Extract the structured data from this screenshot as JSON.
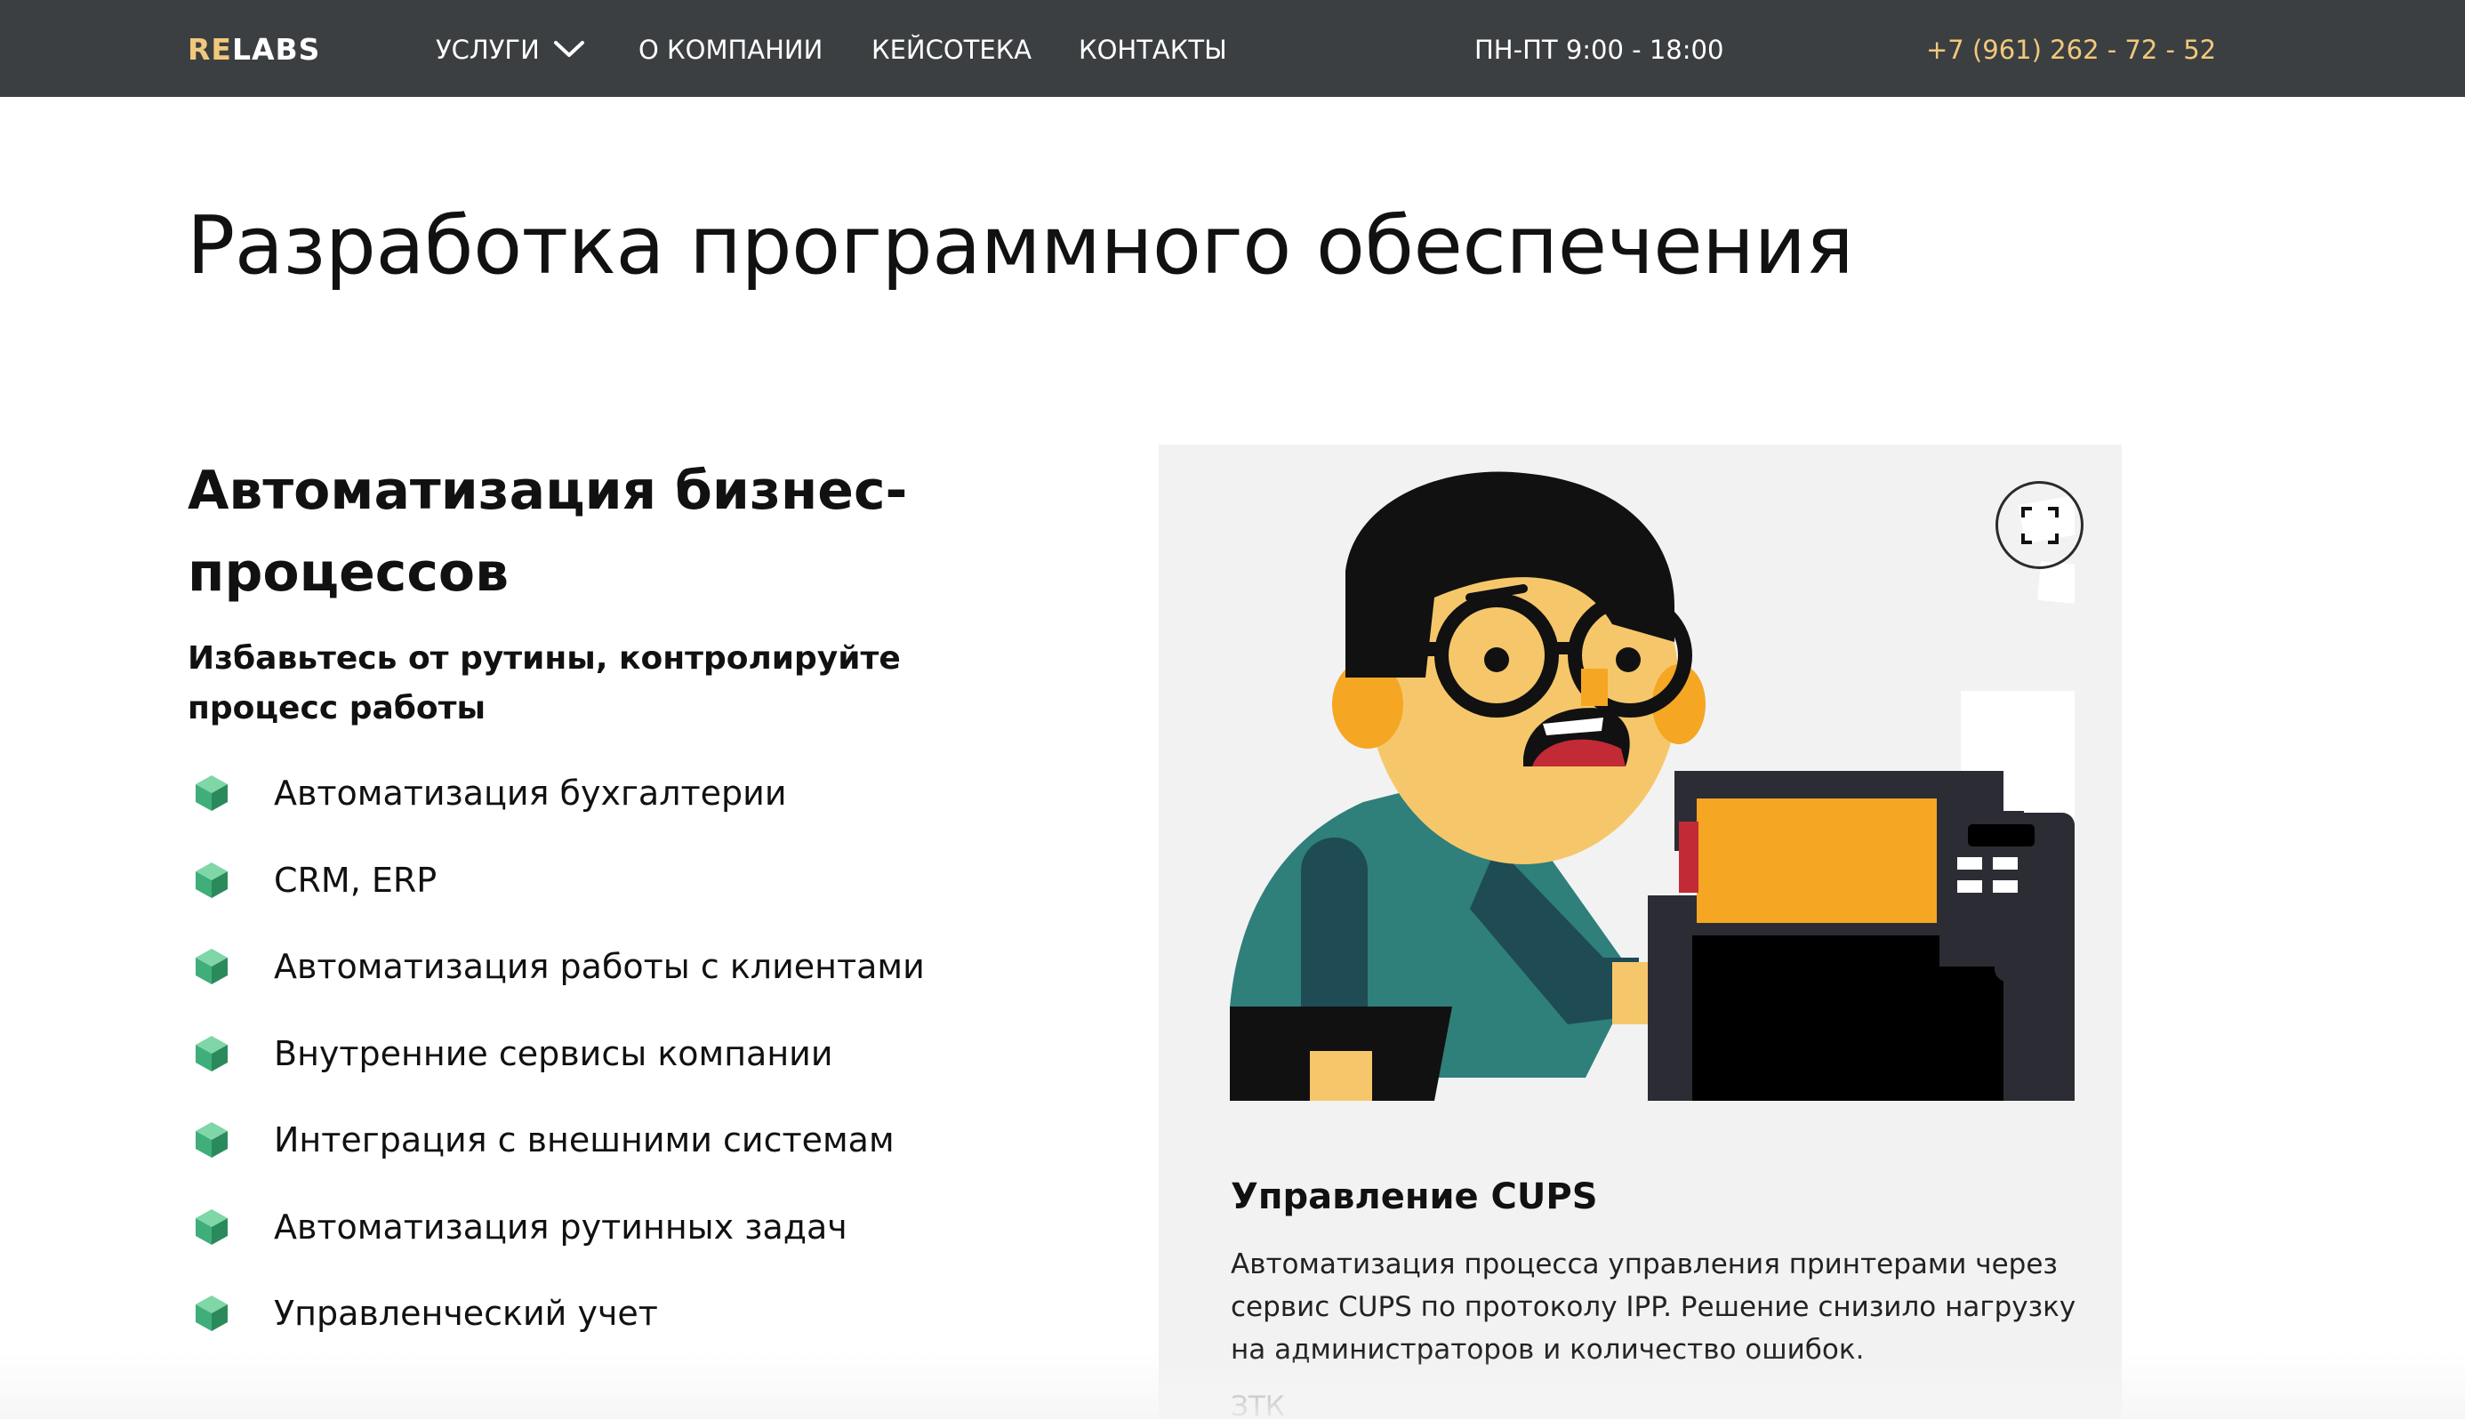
{
  "header": {
    "logo_re": "RE",
    "logo_labs": "LABS",
    "nav": {
      "services": "УСЛУГИ",
      "about": "О КОМПАНИИ",
      "cases": "КЕЙСОТЕКА",
      "contacts": "КОНТАКТЫ"
    },
    "hours": "ПН-ПТ 9:00 - 18:00",
    "phone": "+7 (961) 262 - 72 - 52"
  },
  "page_title": "Разработка программного обеспечения",
  "section": {
    "title": "Автоматизация бизнес-процессов",
    "subtitle": "Избавьтесь от рутины, контролируйте процесс работы",
    "features": [
      "Автоматизация бухгалтерии",
      "CRM, ERP",
      "Автоматизация работы с клиентами",
      "Внутренние сервисы компании",
      "Интеграция с внешними системам",
      "Автоматизация рутинных задач",
      "Управленческий учет"
    ]
  },
  "case_card": {
    "title": "Управление CUPS",
    "description": "Автоматизация процесса управления принтерами через сервис CUPS по протоколу IPP. Решение снизило нагрузку на администраторов и количество ошибок.",
    "client": "ЗТК"
  },
  "colors": {
    "header_bg": "#3c3f41",
    "accent_gold": "#f1c97c",
    "card_bg": "#f2f2f2",
    "cube_green": "#3fae7a"
  },
  "icons": {
    "dropdown": "chevron-down-icon",
    "bullet": "cube-icon",
    "expand": "expand-icon"
  }
}
